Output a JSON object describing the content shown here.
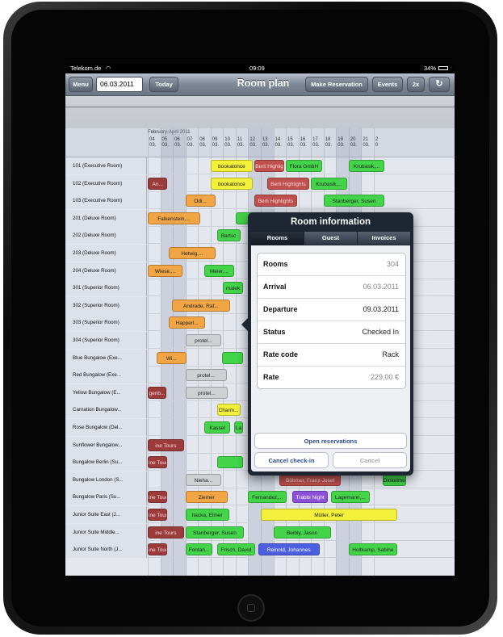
{
  "colors": {
    "green": "#44d44a",
    "yellow": "#f2f03a",
    "red": "#c0504d",
    "orange": "#f2a545",
    "gray": "#cfd0d2",
    "purple": "#8c4fd9",
    "blue": "#4b5fe0",
    "darkred": "#9c3b3b"
  },
  "statusbar": {
    "carrier": "Telekom.de",
    "wifi_icon": "wifi-icon",
    "time": "09:09",
    "battery": "34%"
  },
  "toolbar": {
    "menu": "Menu",
    "date": "06.03.2011",
    "today": "Today",
    "title": "Room plan",
    "make_reservation": "Make Reservation",
    "events": "Events",
    "zoom": "2x",
    "refresh_icon": "refresh-icon"
  },
  "grid": {
    "period": "February-April 2011",
    "days": [
      "04",
      "05",
      "06",
      "07",
      "08",
      "09",
      "10",
      "11",
      "12",
      "13",
      "14",
      "15",
      "16",
      "17",
      "18",
      "19",
      "20",
      "21",
      "2"
    ],
    "months": [
      "03.",
      "03.",
      "03.",
      "03.",
      "03.",
      "03.",
      "03.",
      "03.",
      "03.",
      "03.",
      "03.",
      "03.",
      "03.",
      "03.",
      "03.",
      "03.",
      "03.",
      "03.",
      "0"
    ],
    "rooms": [
      "101 (Executive Room)",
      "102 (Executive Room)",
      "103 (Executive Room)",
      "201 (Deluxe Room)",
      "202 (Deluxe Room)",
      "203 (Deluxe Room)",
      "204 (Deluxe Room)",
      "301 (Superior Room)",
      "302 (Superior Room)",
      "303 (Superior Room)",
      "304 (Superior Room)",
      "Blue Bungalow (Exe...",
      "Red Bungalow (Exe...",
      "Yellow Bungalow (E...",
      "Carnation Bungalow...",
      "Rose Bungalow (Del...",
      "Sunflower Bungalow...",
      "Bungalow Berlin (Su...",
      "Bungalow London (S...",
      "Bungalow Paris (Su...",
      "Junior Suite East (J...",
      "Junior Suite Middle...",
      "Junior Suite North (J..."
    ],
    "bookings": [
      {
        "row": 0,
        "start": 5,
        "span": 3.5,
        "color": "yellow",
        "label": "bookatonce"
      },
      {
        "row": 0,
        "start": 8.5,
        "span": 2.5,
        "color": "red",
        "label": "Berli Highlig"
      },
      {
        "row": 0,
        "start": 11,
        "span": 3,
        "color": "green",
        "label": "Flora GmbH"
      },
      {
        "row": 0,
        "start": 16,
        "span": 3,
        "color": "green",
        "label": "Krubasik,..."
      },
      {
        "row": 1,
        "start": 0,
        "span": 1.7,
        "color": "darkred",
        "label": "An..."
      },
      {
        "row": 1,
        "start": 5,
        "span": 3.5,
        "color": "yellow",
        "label": "bookatonce"
      },
      {
        "row": 1,
        "start": 9.5,
        "span": 3.5,
        "color": "red",
        "label": "Berli Highlights"
      },
      {
        "row": 1,
        "start": 13,
        "span": 3,
        "color": "green",
        "label": "Krubasik,..."
      },
      {
        "row": 2,
        "start": 3,
        "span": 2.5,
        "color": "orange",
        "label": "Odi..."
      },
      {
        "row": 2,
        "start": 8.5,
        "span": 3.5,
        "color": "red",
        "label": "Berli Highlights"
      },
      {
        "row": 2,
        "start": 14,
        "span": 5,
        "color": "green",
        "label": "Stanberger, Susen"
      },
      {
        "row": 3,
        "start": 0,
        "span": 4.3,
        "color": "orange",
        "label": "Falkenstein,..."
      },
      {
        "row": 3,
        "start": 7,
        "span": 1.5,
        "color": "green",
        "label": ""
      },
      {
        "row": 3,
        "start": 16,
        "span": 3,
        "color": "green",
        "label": "Peterse"
      },
      {
        "row": 4,
        "start": 5.5,
        "span": 2,
        "color": "green",
        "label": "Bartsc"
      },
      {
        "row": 5,
        "start": 1.7,
        "span": 3.8,
        "color": "orange",
        "label": "Hetwig,..."
      },
      {
        "row": 5,
        "start": 16,
        "span": 3,
        "color": "green",
        "label": "r, Sami"
      },
      {
        "row": 6,
        "start": 0,
        "span": 2.9,
        "color": "orange",
        "label": "Wiese,..."
      },
      {
        "row": 6,
        "start": 4.5,
        "span": 2.5,
        "color": "green",
        "label": "Meier,..."
      },
      {
        "row": 6,
        "start": 17,
        "span": 2,
        "color": "blue",
        "label": "Danone"
      },
      {
        "row": 7,
        "start": 6,
        "span": 1.7,
        "color": "green",
        "label": "malek"
      },
      {
        "row": 8,
        "start": 1.9,
        "span": 4.8,
        "color": "orange",
        "label": "Andrade, Raf..."
      },
      {
        "row": 8,
        "start": 16,
        "span": 3,
        "color": "green",
        "label": "ssus"
      },
      {
        "row": 9,
        "start": 1.7,
        "span": 3,
        "color": "orange",
        "label": "Happerl..."
      },
      {
        "row": 10,
        "start": 3,
        "span": 3,
        "color": "gray",
        "label": "protel..."
      },
      {
        "row": 10,
        "start": 16,
        "span": 3,
        "color": "red",
        "label": "t-Moe, Kle"
      },
      {
        "row": 11,
        "start": 0.7,
        "span": 2.5,
        "color": "orange",
        "label": "Wi..."
      },
      {
        "row": 11,
        "start": 5.9,
        "span": 1.8,
        "color": "green",
        "label": ""
      },
      {
        "row": 12,
        "start": 3,
        "span": 3.4,
        "color": "gray",
        "label": "protel..."
      },
      {
        "row": 12,
        "start": 16.2,
        "span": 1.8,
        "color": "blue",
        "label": "Ki"
      },
      {
        "row": 13,
        "start": 0,
        "span": 1.6,
        "color": "darkred",
        "label": "genb..."
      },
      {
        "row": 13,
        "start": 3,
        "span": 3.5,
        "color": "gray",
        "label": "protel..."
      },
      {
        "row": 13,
        "start": 16,
        "span": 3,
        "color": "green",
        "label": "termann, F"
      },
      {
        "row": 14,
        "start": 5.5,
        "span": 2,
        "color": "yellow",
        "label": "Charm..."
      },
      {
        "row": 15,
        "start": 4.5,
        "span": 2.2,
        "color": "green",
        "label": "Kassel"
      },
      {
        "row": 15,
        "start": 6.9,
        "span": 0.8,
        "color": "green",
        "label": "La"
      },
      {
        "row": 15,
        "start": 16,
        "span": 2,
        "color": "green",
        "label": "ns"
      },
      {
        "row": 16,
        "start": 0,
        "span": 3,
        "color": "darkred",
        "label": "ine Tours"
      },
      {
        "row": 16,
        "start": 16,
        "span": 1.6,
        "color": "green",
        "label": "S..."
      },
      {
        "row": 17,
        "start": 0,
        "span": 1.7,
        "color": "darkred",
        "label": "ine Tours"
      },
      {
        "row": 17,
        "start": 5.5,
        "span": 2.2,
        "color": "green",
        "label": ""
      },
      {
        "row": 18,
        "start": 3,
        "span": 3,
        "color": "gray",
        "label": "Nieha..."
      },
      {
        "row": 18,
        "start": 10.5,
        "span": 5,
        "color": "red",
        "label": "Böhmer, Franz-Josef"
      },
      {
        "row": 18,
        "start": 18.7,
        "span": 2,
        "color": "green",
        "label": "Dinkelme"
      },
      {
        "row": 19,
        "start": 0,
        "span": 1.7,
        "color": "darkred",
        "label": "ine Tours"
      },
      {
        "row": 19,
        "start": 3,
        "span": 3.5,
        "color": "orange",
        "label": "Ziemer"
      },
      {
        "row": 19,
        "start": 8,
        "span": 3.2,
        "color": "green",
        "label": "Fernandez,..."
      },
      {
        "row": 19,
        "start": 11.5,
        "span": 3,
        "color": "purple",
        "label": "Trabbi Night"
      },
      {
        "row": 19,
        "start": 14.6,
        "span": 3.2,
        "color": "green",
        "label": "Lagemann,..."
      },
      {
        "row": 20,
        "start": 0,
        "span": 1.7,
        "color": "darkred",
        "label": "ine Tours"
      },
      {
        "row": 20,
        "start": 3,
        "span": 3.6,
        "color": "green",
        "label": "Itacka, Elmer"
      },
      {
        "row": 20,
        "start": 9,
        "span": 11,
        "color": "yellow",
        "label": "Müller, Peter"
      },
      {
        "row": 21,
        "start": 0,
        "span": 3,
        "color": "darkred",
        "label": "ine Tours"
      },
      {
        "row": 21,
        "start": 3,
        "span": 4.8,
        "color": "green",
        "label": "Stanberger, Susen"
      },
      {
        "row": 21,
        "start": 10,
        "span": 4.7,
        "color": "green",
        "label": "Beibly, Jason"
      },
      {
        "row": 22,
        "start": 0,
        "span": 1.7,
        "color": "darkred",
        "label": "ine Tours"
      },
      {
        "row": 22,
        "start": 3,
        "span": 2.3,
        "color": "green",
        "label": "Fontan..."
      },
      {
        "row": 22,
        "start": 5.5,
        "span": 3.2,
        "color": "green",
        "label": "Frisch, David"
      },
      {
        "row": 22,
        "start": 8.8,
        "span": 5,
        "color": "blue",
        "label": "Reinold, Johannes"
      },
      {
        "row": 22,
        "start": 16,
        "span": 4,
        "color": "green",
        "label": "Holtkamp, Sabine"
      }
    ]
  },
  "popover": {
    "title": "Room information",
    "tabs": [
      "Rooms",
      "Guest",
      "Invoices"
    ],
    "fields": [
      {
        "label": "Rooms",
        "value": "304"
      },
      {
        "label": "Arrival",
        "value": "06.03.2011"
      },
      {
        "label": "Departure",
        "value": "09.03.2011"
      },
      {
        "label": "Status",
        "value": "Checked In"
      },
      {
        "label": "Rate code",
        "value": "Rack"
      },
      {
        "label": "Rate",
        "value": "229,00 €"
      }
    ],
    "open_reservations": "Open reservations",
    "cancel_checkin": "Cancel check-in",
    "cancel": "Cancel"
  }
}
